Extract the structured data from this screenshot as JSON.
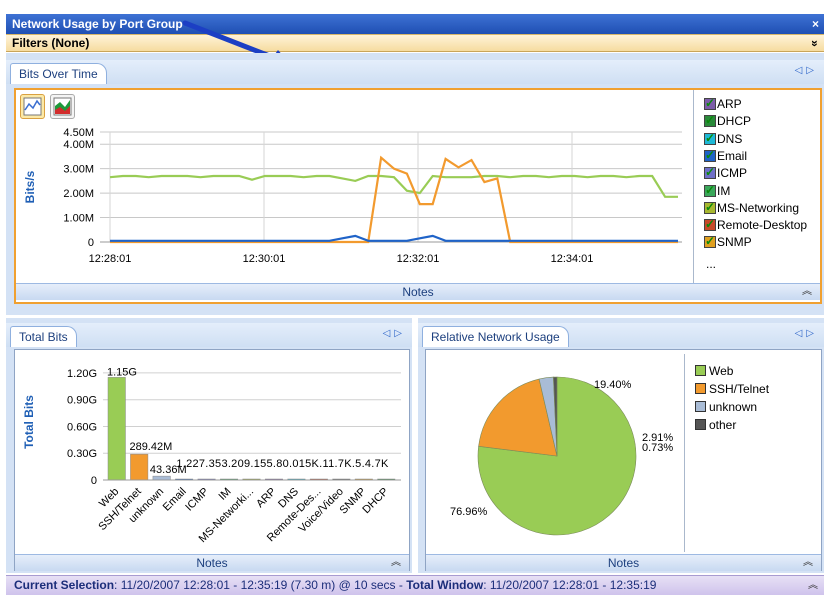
{
  "window": {
    "title": "Network Usage by Port Group",
    "close_label": "×"
  },
  "filters": {
    "label": "Filters (None)",
    "expand_label": "»"
  },
  "top_panel": {
    "tab_label": "Bits Over Time",
    "notes_label": "Notes",
    "legend": [
      {
        "label": "ARP",
        "color": "#7c5da8"
      },
      {
        "label": "DHCP",
        "color": "#2a8a3a"
      },
      {
        "label": "DNS",
        "color": "#1eb8d6"
      },
      {
        "label": "Email",
        "color": "#1f63c8"
      },
      {
        "label": "ICMP",
        "color": "#6f6fc8"
      },
      {
        "label": "IM",
        "color": "#3aa75a"
      },
      {
        "label": "MS-Networking",
        "color": "#a8b830"
      },
      {
        "label": "Remote-Desktop",
        "color": "#c84a2a"
      },
      {
        "label": "SNMP",
        "color": "#e0a020"
      }
    ],
    "legend_more": "..."
  },
  "bottom_left": {
    "tab_label": "Total Bits",
    "notes_label": "Notes"
  },
  "bottom_right": {
    "tab_label": "Relative Network Usage",
    "notes_label": "Notes"
  },
  "status": {
    "current_label": "Current Selection",
    "current_value": ": 11/20/2007 12:28:01 - 12:35:19 (7.30 m) @ 10 secs -",
    "total_label": "Total Window",
    "total_value": ": 11/20/2007 12:28:01 - 12:35:19"
  },
  "colors": {
    "web": "#99cc55",
    "ssh": "#f29a2e",
    "unknown": "#a9bcd6",
    "other": "#555555",
    "accent": "#2a56c6"
  },
  "chart_data": [
    {
      "type": "line",
      "ylabel": "Bits/s",
      "y_ticks": [
        "0",
        "1.00M",
        "2.00M",
        "3.00M",
        "4.00M",
        "4.50M"
      ],
      "x_ticks": [
        "12:28:01",
        "12:30:01",
        "12:32:01",
        "12:34:01"
      ],
      "ylim": [
        0,
        4500000
      ],
      "series": [
        {
          "name": "Web",
          "color": "#99cc55",
          "values": [
            2.65,
            2.7,
            2.7,
            2.65,
            2.7,
            2.7,
            2.7,
            2.65,
            2.7,
            2.7,
            2.7,
            2.55,
            2.7,
            2.7,
            2.7,
            2.65,
            2.7,
            2.7,
            2.6,
            2.5,
            2.7,
            2.7,
            2.65,
            2.1,
            2.0,
            2.7,
            2.65,
            2.65,
            2.65,
            2.7,
            2.7,
            2.65,
            2.7,
            2.7,
            2.65,
            2.7,
            2.7,
            2.65,
            2.7,
            2.7,
            2.65,
            2.7,
            2.7,
            1.85,
            1.85
          ]
        },
        {
          "name": "SSH/Telnet",
          "color": "#f29a2e",
          "values": [
            0,
            0,
            0,
            0,
            0,
            0,
            0,
            0,
            0,
            0,
            0,
            0,
            0,
            0,
            0,
            0,
            0,
            0,
            0,
            0,
            0,
            3.45,
            3.0,
            2.8,
            1.55,
            1.55,
            3.4,
            3.05,
            3.35,
            2.45,
            2.6,
            0,
            0,
            0,
            0,
            0,
            0,
            0,
            0,
            0,
            0,
            0,
            0,
            0,
            0
          ]
        },
        {
          "name": "Email",
          "color": "#1f63c8",
          "values": [
            0.05,
            0.05,
            0.05,
            0.05,
            0.05,
            0.05,
            0.05,
            0.05,
            0.05,
            0.05,
            0.05,
            0.05,
            0.05,
            0.05,
            0.05,
            0.05,
            0.05,
            0.05,
            0.15,
            0.25,
            0.05,
            0.05,
            0.05,
            0.05,
            0.15,
            0.25,
            0.05,
            0.05,
            0.05,
            0.05,
            0.05,
            0.05,
            0.05,
            0.05,
            0.05,
            0.05,
            0.05,
            0.05,
            0.05,
            0.05,
            0.05,
            0.05,
            0.05,
            0.05,
            0.05
          ]
        }
      ]
    },
    {
      "type": "bar",
      "ylabel": "Total Bits",
      "y_ticks": [
        "0",
        "0.30G",
        "0.60G",
        "0.90G",
        "1.20G"
      ],
      "ylim": [
        0,
        1300000000
      ],
      "categories": [
        "Web",
        "SSH/Telnet",
        "unknown",
        "Email",
        "ICMP",
        "IM",
        "MS-Networki...",
        "ARP",
        "DNS",
        "Remote-Des...",
        "Voice/Video",
        "SNMP",
        "DHCP"
      ],
      "values": [
        1150000000,
        289420000,
        43360000,
        1227000,
        353000,
        209000,
        155000,
        80000,
        15000,
        11000,
        7000,
        5000,
        4700
      ],
      "value_labels": [
        "1.15G",
        "289.42M",
        "43.36M",
        "1.227.353.209.155.80.015K.11.7K.5.4.7K"
      ],
      "bar_colors": [
        "#99cc55",
        "#f29a2e",
        "#a9bcd6",
        "#1f63c8",
        "#6f6fc8",
        "#3aa75a",
        "#a8b830",
        "#7c5da8",
        "#1eb8d6",
        "#c84a2a",
        "#5a5a5a",
        "#e0a020",
        "#2a8a3a"
      ]
    },
    {
      "type": "pie",
      "slices": [
        {
          "label": "Web",
          "value": 76.96,
          "text": "76.96%",
          "color": "#99cc55"
        },
        {
          "label": "SSH/Telnet",
          "value": 19.4,
          "text": "19.40%",
          "color": "#f29a2e"
        },
        {
          "label": "unknown",
          "value": 2.91,
          "text": "2.91%",
          "color": "#a9bcd6"
        },
        {
          "label": "other",
          "value": 0.73,
          "text": "0.73%",
          "color": "#555555"
        }
      ]
    }
  ]
}
